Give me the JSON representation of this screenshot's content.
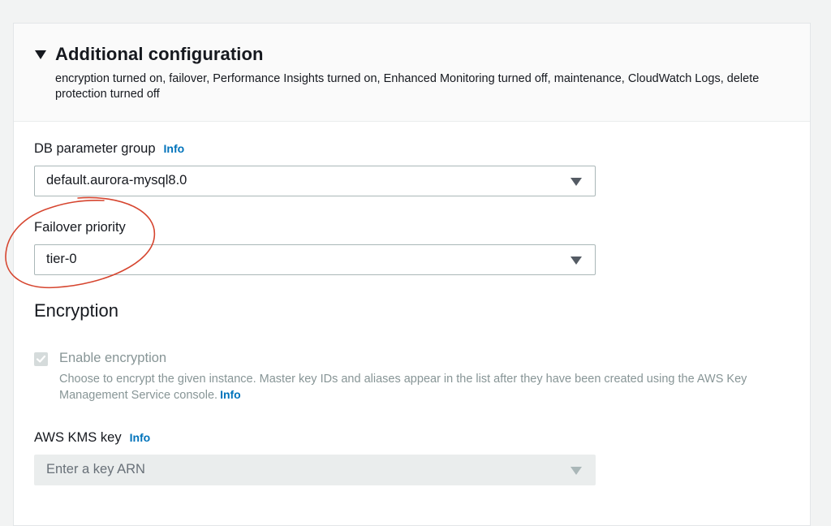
{
  "additional_configuration": {
    "title": "Additional configuration",
    "summary": "encryption turned on, failover, Performance Insights turned on, Enhanced Monitoring turned off, maintenance, CloudWatch Logs, delete protection turned off",
    "icon": "caret-down-icon"
  },
  "db_parameter_group": {
    "label": "DB parameter group",
    "info": "Info",
    "value": "default.aurora-mysql8.0"
  },
  "failover_priority": {
    "label": "Failover priority",
    "value": "tier-0"
  },
  "encryption": {
    "title": "Encryption",
    "checkbox_label": "Enable encryption",
    "checked": true,
    "disabled": true,
    "description": "Choose to encrypt the given instance. Master key IDs and aliases appear in the list after they have been created using the AWS Key Management Service console.",
    "info": "Info"
  },
  "kms_key": {
    "label": "AWS KMS key",
    "info": "Info",
    "placeholder": "Enter a key ARN"
  },
  "colors": {
    "link": "#0073bb",
    "annotation": "#d6452f",
    "disabled_text": "#879596"
  }
}
